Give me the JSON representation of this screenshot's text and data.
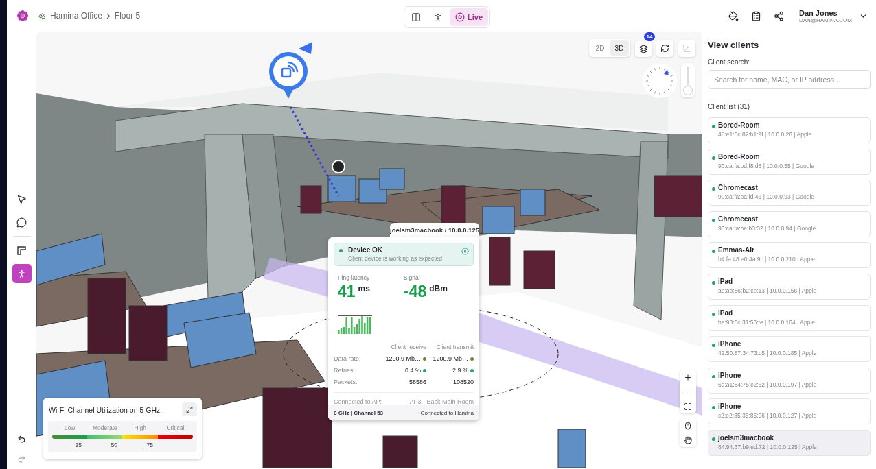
{
  "breadcrumb": [
    {
      "kind": "site",
      "label": "Hamina Office"
    },
    {
      "kind": "floor",
      "label": "Floor 5"
    }
  ],
  "mode_tabs": [
    {
      "kind": "split",
      "selected": false
    },
    {
      "kind": "walk",
      "selected": false
    },
    {
      "kind": "live",
      "label": "Live",
      "selected": true
    }
  ],
  "top_actions": [
    {
      "kind": "paint"
    },
    {
      "kind": "report"
    },
    {
      "kind": "share"
    }
  ],
  "user": {
    "name": "Dan Jones",
    "email": "DAN@HAMINA.COM"
  },
  "left_tools": [
    {
      "kind": "pointer",
      "selected": false
    },
    {
      "kind": "comment",
      "selected": false
    },
    {
      "kind": "wall",
      "selected": false
    },
    {
      "kind": "walk",
      "selected": true
    }
  ],
  "view_toggle": [
    {
      "label": "2D",
      "selected": false
    },
    {
      "label": "3D",
      "selected": true
    }
  ],
  "layers_badge": "14",
  "zoom_slider": {
    "level": 0.12
  },
  "popup": {
    "title": "joelsm3macbook / 10.0.0.125",
    "status": {
      "title": "Device OK",
      "text": "Client device is working as expected",
      "color": "#2e9c7e"
    },
    "metrics": [
      {
        "label": "Ping latency",
        "value": "41",
        "unit": "ms"
      },
      {
        "label": "Signal",
        "value": "-48",
        "unit": "dBm"
      }
    ],
    "columns": [
      "Client receive",
      "Client transmit"
    ],
    "rows": [
      {
        "label": "Data rate:",
        "receive": {
          "value": "1200.9 Mb…",
          "color": "#5e8c2e"
        },
        "transmit": {
          "value": "1200.9 Mb…",
          "color": "#5e8c2e"
        }
      },
      {
        "label": "Retries:",
        "receive": {
          "value": "0.4 %",
          "color": "#2e9c7e"
        },
        "transmit": {
          "value": "2.9 %",
          "color": "#2e9c7e"
        }
      },
      {
        "label": "Packets:",
        "receive": {
          "value": "58586"
        },
        "transmit": {
          "value": "108520"
        }
      }
    ],
    "faded_row": {
      "label": "Connected to AP:",
      "value": "AP3 - Back Main Room"
    },
    "footer": {
      "band": "6 GHz | Channel 53",
      "connection": "Connected to Hamina"
    }
  },
  "legend": {
    "title": "Wi-Fi Channel Utilization on 5 GHz",
    "levels": [
      "Low",
      "Moderate",
      "High",
      "Critical"
    ],
    "ticks": [
      "25",
      "50",
      "75"
    ]
  },
  "panel": {
    "title": "View clients",
    "search_label": "Client search:",
    "search_placeholder": "Search for name, MAC, or IP address...",
    "list_title": "Client list (31)",
    "clients": [
      {
        "name": "Bored-Room",
        "details": "48:e1:5c:82:b1:9f | 10.0.0.26 | Apple",
        "color": "#2e9c7e",
        "selected": false
      },
      {
        "name": "Bored-Room",
        "details": "90:ca:fa:bd:f8:d8 | 10.0.0.55 | Google",
        "color": "#2e9c7e",
        "selected": false
      },
      {
        "name": "Chromecast",
        "details": "90:ca:fa:ba:fd:46 | 10.0.0.93 | Google",
        "color": "#2e9c7e",
        "selected": false
      },
      {
        "name": "Chromecast",
        "details": "90:ca:fa:be:b3:32 | 10.0.0.94 | Google",
        "color": "#2e9c7e",
        "selected": false
      },
      {
        "name": "Emmas-Air",
        "details": "b4:fa:48:e0:4a:9c | 10.0.0.210 | Apple",
        "color": "#2e9c7e",
        "selected": false
      },
      {
        "name": "iPad",
        "details": "ae:ab:86:b2:ce:13 | 10.0.0.156 | Apple",
        "color": "#2e9c7e",
        "selected": false
      },
      {
        "name": "iPad",
        "details": "be:93:6c:31:56:fe | 10.0.0.164 | Apple",
        "color": "#2e9c7e",
        "selected": false
      },
      {
        "name": "iPhone",
        "details": "42:50:87:34:73:c5 | 10.0.0.185 | Apple",
        "color": "#2e9c7e",
        "selected": false
      },
      {
        "name": "iPhone",
        "details": "6e:a1:84:75:c2:62 | 10.0.0.197 | Apple",
        "color": "#2e9c7e",
        "selected": false
      },
      {
        "name": "iPhone",
        "details": "c2:e2:85:35:85:96 | 10.0.0.127 | Apple",
        "color": "#2e9c7e",
        "selected": false
      },
      {
        "name": "joelsm3macbook",
        "details": "84:94:37:b9:ed:72 | 10.0.0.125 | Apple",
        "color": "#2e9c7e",
        "selected": true
      }
    ]
  }
}
